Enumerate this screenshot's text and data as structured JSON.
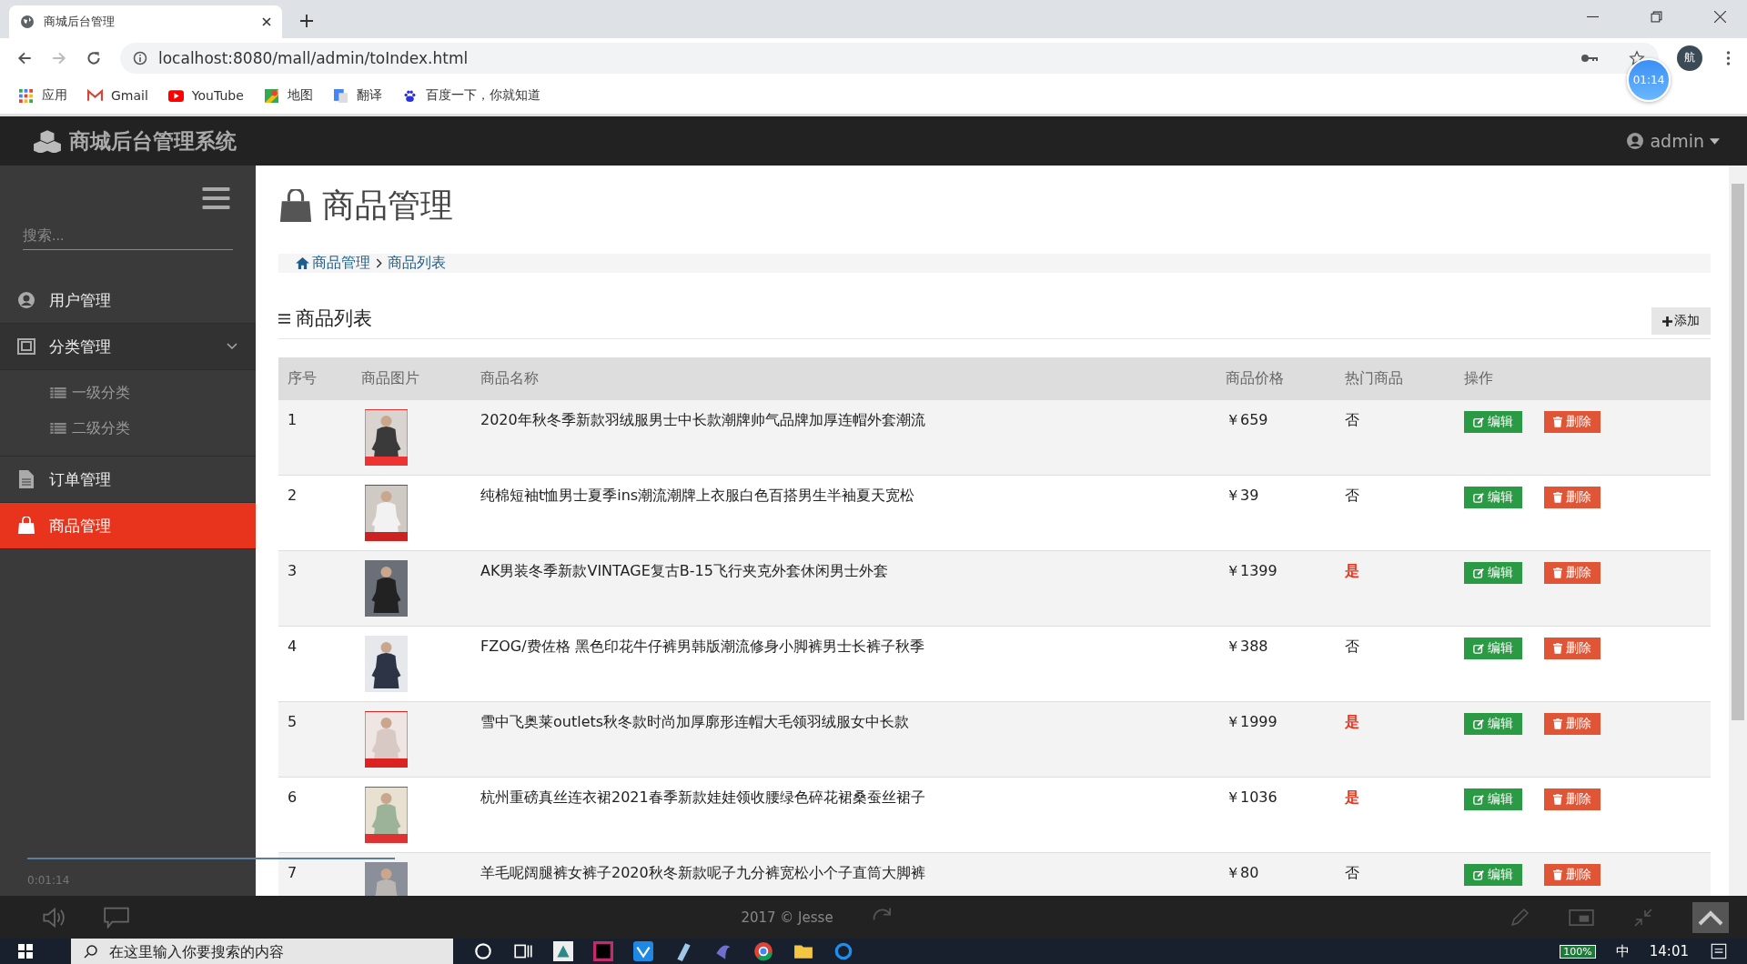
{
  "browser": {
    "tab_title": "商城后台管理",
    "url": "localhost:8080/mall/admin/toIndex.html",
    "profile": "航",
    "bookmarks": [
      {
        "label": "应用",
        "kind": "apps"
      },
      {
        "label": "Gmail",
        "kind": "gmail"
      },
      {
        "label": "YouTube",
        "kind": "youtube"
      },
      {
        "label": "地图",
        "kind": "maps"
      },
      {
        "label": "翻译",
        "kind": "translate"
      },
      {
        "label": "百度一下，你就知道",
        "kind": "baidu"
      }
    ]
  },
  "recorder_badge": "01:14",
  "header": {
    "brand": "商城后台管理系统",
    "user": "admin"
  },
  "sidebar": {
    "search_placeholder": "搜索...",
    "items": [
      {
        "label": "用户管理",
        "kind": "user",
        "selected": false
      },
      {
        "label": "分类管理",
        "kind": "category",
        "selected": false,
        "expanded": true,
        "children": [
          {
            "label": "一级分类"
          },
          {
            "label": "二级分类"
          }
        ]
      },
      {
        "label": "订单管理",
        "kind": "order",
        "selected": false
      },
      {
        "label": "商品管理",
        "kind": "goods",
        "selected": true
      }
    ]
  },
  "page": {
    "title": "商品管理",
    "breadcrumb": [
      "商品管理",
      "商品列表"
    ],
    "section_title": "商品列表",
    "add_button": "添加",
    "table": {
      "columns": [
        "序号",
        "商品图片",
        "商品名称",
        "商品价格",
        "热门商品",
        "操作"
      ],
      "rows": [
        {
          "index": "1",
          "name": "2020年秋冬季新款羽绒服男士中长款潮牌帅气品牌加厚连帽外套潮流",
          "price": "￥659",
          "hot_label": "否",
          "hot": false,
          "edit": "编辑",
          "delete": "删除"
        },
        {
          "index": "2",
          "name": "纯棉短袖t恤男士夏季ins潮流潮牌上衣服白色百搭男生半袖夏天宽松",
          "price": "￥39",
          "hot_label": "否",
          "hot": false,
          "edit": "编辑",
          "delete": "删除"
        },
        {
          "index": "3",
          "name": "AK男装冬季新款VINTAGE复古B-15飞行夹克外套休闲男士外套",
          "price": "￥1399",
          "hot_label": "是",
          "hot": true,
          "edit": "编辑",
          "delete": "删除"
        },
        {
          "index": "4",
          "name": "FZOG/费佐格 黑色印花牛仔裤男韩版潮流修身小脚裤男士长裤子秋季",
          "price": "￥388",
          "hot_label": "否",
          "hot": false,
          "edit": "编辑",
          "delete": "删除"
        },
        {
          "index": "5",
          "name": "雪中飞奥莱outlets秋冬款时尚加厚廓形连帽大毛领羽绒服女中长款",
          "price": "￥1999",
          "hot_label": "是",
          "hot": true,
          "edit": "编辑",
          "delete": "删除"
        },
        {
          "index": "6",
          "name": "杭州重磅真丝连衣裙2021春季新款娃娃领收腰绿色碎花裙桑蚕丝裙子",
          "price": "￥1036",
          "hot_label": "是",
          "hot": true,
          "edit": "编辑",
          "delete": "删除"
        },
        {
          "index": "7",
          "name": "羊毛呢阔腿裤女裤子2020秋冬新款呢子九分裤宽松小个子直筒大脚裤",
          "price": "￥80",
          "hot_label": "否",
          "hot": false,
          "edit": "编辑",
          "delete": "删除"
        }
      ]
    }
  },
  "player": {
    "elapsed": "0:01:14",
    "footer": "2017 © Jesse"
  },
  "taskbar": {
    "search_placeholder": "在这里输入你要搜索的内容",
    "battery": "100%",
    "ime": "中",
    "clock": "14:01"
  }
}
